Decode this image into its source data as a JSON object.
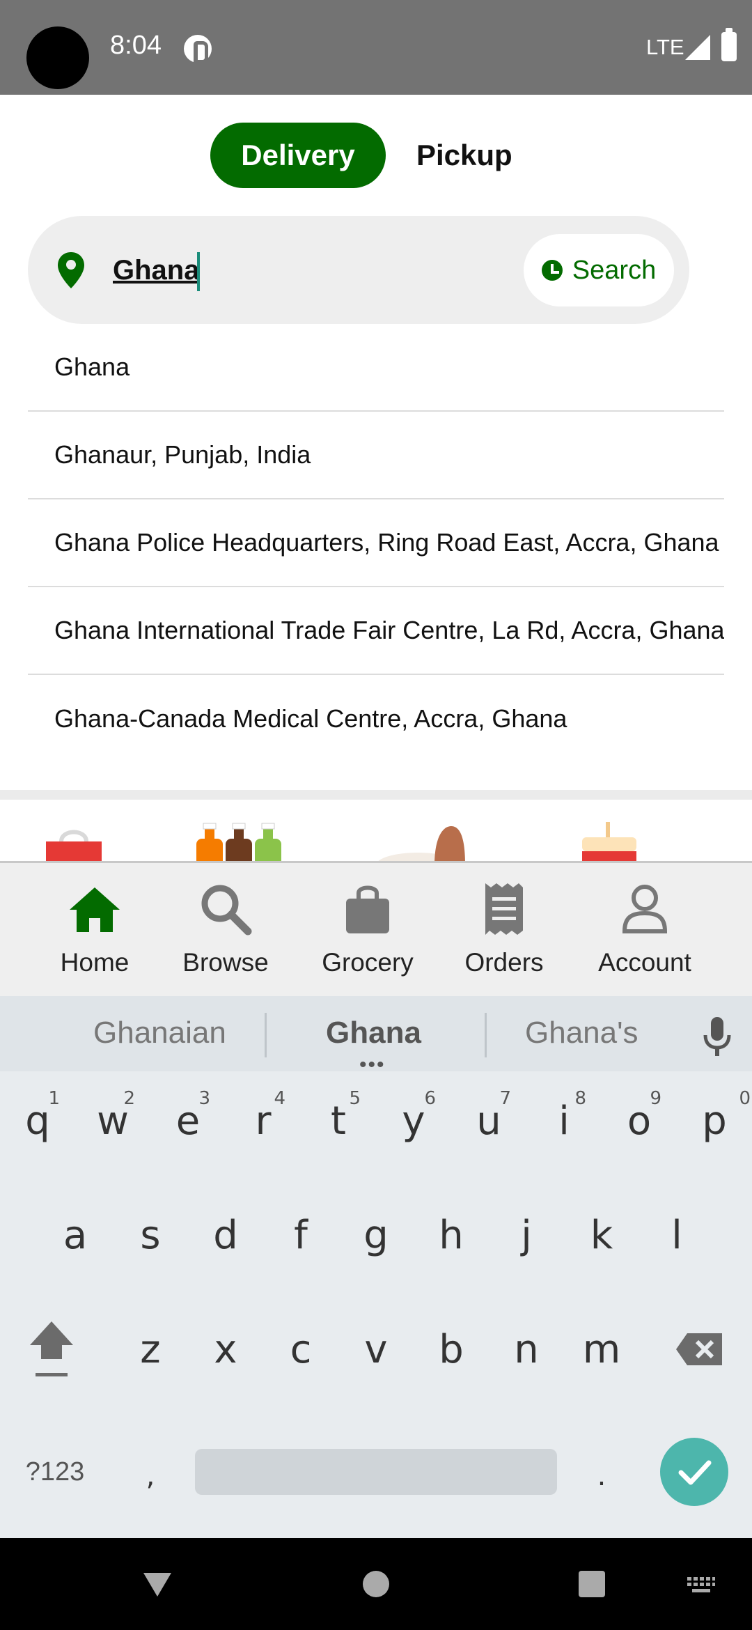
{
  "status_bar": {
    "time": "8:04",
    "network": "LTE"
  },
  "mode_toggle": {
    "delivery": "Delivery",
    "pickup": "Pickup"
  },
  "search": {
    "value": "Ghana",
    "button": "Search"
  },
  "suggestions": [
    "Ghana",
    "Ghanaur, Punjab, India",
    "Ghana Police Headquarters, Ring Road East, Accra, Ghana",
    "Ghana International Trade Fair Centre, La Rd, Accra, Ghana",
    "Ghana-Canada Medical Centre, Accra, Ghana"
  ],
  "bottom_nav": [
    "Home",
    "Browse",
    "Grocery",
    "Orders",
    "Account"
  ],
  "accent_color": "#036b00",
  "keyboard": {
    "suggestions": [
      "Ghanaian",
      "Ghana",
      "Ghana's"
    ],
    "row1": [
      "q",
      "w",
      "e",
      "r",
      "t",
      "y",
      "u",
      "i",
      "o",
      "p"
    ],
    "row1_numbers": [
      "1",
      "2",
      "3",
      "4",
      "5",
      "6",
      "7",
      "8",
      "9",
      "0"
    ],
    "row2": [
      "a",
      "s",
      "d",
      "f",
      "g",
      "h",
      "j",
      "k",
      "l"
    ],
    "row3": [
      "z",
      "x",
      "c",
      "v",
      "b",
      "n",
      "m"
    ],
    "symbols_key": "?123",
    "comma_key": ",",
    "period_key": "."
  }
}
